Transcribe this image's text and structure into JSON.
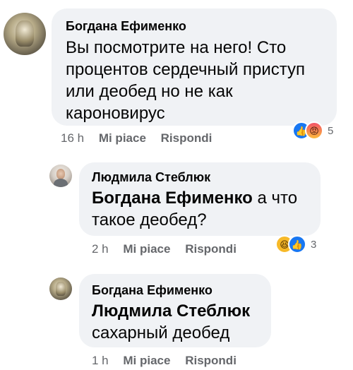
{
  "comments": [
    {
      "author": "Богдана Ефименко",
      "text": "Вы посмотрите на него! Сто процентов сердечный приступ или деобед но не как кароновирус",
      "time": "16 h",
      "like_label": "Mi piace",
      "reply_label": "Rispondi",
      "reaction_count": "5"
    },
    {
      "author": "Людмила Стеблюк",
      "mention": "Богдана Ефименко",
      "text": " а что такое деобед?",
      "time": "2 h",
      "like_label": "Mi piace",
      "reply_label": "Rispondi",
      "reaction_count": "3"
    },
    {
      "author": "Богдана Ефименко",
      "mention": "Людмила Стеблюк",
      "text": "сахарный деобед",
      "time": "1 h",
      "like_label": "Mi piace",
      "reply_label": "Rispondi"
    }
  ]
}
